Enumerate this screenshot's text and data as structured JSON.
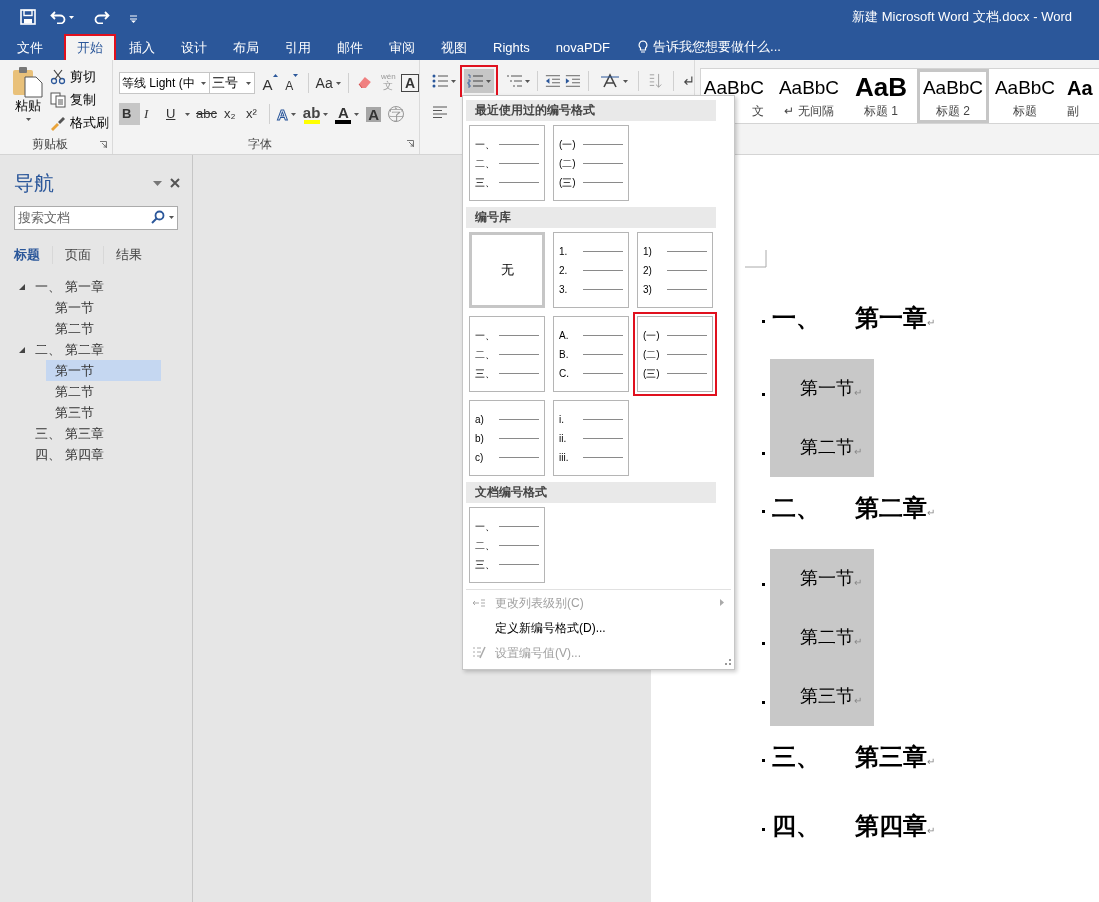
{
  "window": {
    "title": "新建 Microsoft Word 文档.docx - Word"
  },
  "tabs": [
    {
      "label": "文件",
      "selected": false,
      "highlighted": false
    },
    {
      "label": "开始",
      "selected": true,
      "highlighted": true
    },
    {
      "label": "插入",
      "selected": false,
      "highlighted": false
    },
    {
      "label": "设计",
      "selected": false,
      "highlighted": false
    },
    {
      "label": "布局",
      "selected": false,
      "highlighted": false
    },
    {
      "label": "引用",
      "selected": false,
      "highlighted": false
    },
    {
      "label": "邮件",
      "selected": false,
      "highlighted": false
    },
    {
      "label": "审阅",
      "selected": false,
      "highlighted": false
    },
    {
      "label": "视图",
      "selected": false,
      "highlighted": false
    },
    {
      "label": "Rights",
      "selected": false,
      "highlighted": false
    },
    {
      "label": "novaPDF",
      "selected": false,
      "highlighted": false
    }
  ],
  "tell_me": {
    "placeholder": "告诉我您想要做什么..."
  },
  "clipboard": {
    "label": "剪贴板",
    "paste": "粘贴",
    "actions": [
      {
        "label": "剪切",
        "kind": "cut"
      },
      {
        "label": "复制",
        "kind": "copy"
      },
      {
        "label": "格式刷",
        "kind": "painter"
      }
    ]
  },
  "font": {
    "label": "字体",
    "name": "等线 Light (中",
    "size": "三号",
    "size_buttons": [
      {
        "label": "A",
        "kind": "grow"
      },
      {
        "label": "A",
        "kind": "shrink"
      }
    ],
    "change_case": "Aa",
    "phonetic": {
      "top": "wén",
      "bottom": "文"
    },
    "border_char": "A",
    "format_buttons": [
      {
        "label": "B",
        "kind": "bold",
        "selected": true
      },
      {
        "label": "I",
        "kind": "italic",
        "selected": false
      },
      {
        "label": "U",
        "kind": "underline",
        "selected": false
      },
      {
        "label": "abc",
        "kind": "strike",
        "selected": false
      },
      {
        "label": "x₂",
        "kind": "plain",
        "selected": false
      },
      {
        "label": "x²",
        "kind": "plain",
        "selected": false
      }
    ],
    "color_buttons": [
      {
        "label": "A",
        "kind": "effect"
      },
      {
        "label": "ab",
        "kind": "highlight",
        "color": "#ffff00"
      },
      {
        "label": "A",
        "kind": "font_color",
        "color": "#000000"
      },
      {
        "label": "A",
        "kind": "shading"
      },
      {
        "label": "字",
        "kind": "enclose"
      }
    ]
  },
  "numbering_button": {
    "selected": true,
    "highlighted": true
  },
  "styles": [
    {
      "preview": "AaBbC",
      "label": "文",
      "kind": "normal",
      "selected": false
    },
    {
      "preview": "AaBbC",
      "label": "↵ 无间隔",
      "kind": "normal",
      "selected": false
    },
    {
      "preview": "AaB",
      "label": "标题 1",
      "kind": "heading",
      "selected": false
    },
    {
      "preview": "AaBbC",
      "label": "标题 2",
      "kind": "normal",
      "selected": true
    },
    {
      "preview": "AaBbC",
      "label": "标题",
      "kind": "normal",
      "selected": false
    },
    {
      "preview": "Aa",
      "label": "副",
      "kind": "bold",
      "selected": false
    }
  ],
  "navigation": {
    "title": "导航",
    "search": {
      "placeholder": "搜索文档"
    },
    "tabs": [
      {
        "label": "标题",
        "selected": true
      },
      {
        "label": "页面",
        "selected": false
      },
      {
        "label": "结果",
        "selected": false
      }
    ],
    "tree": [
      {
        "label": "一、 第一章",
        "expanded": true,
        "selected": false,
        "children": [
          {
            "label": "第一节",
            "selected": false
          },
          {
            "label": "第二节",
            "selected": false
          }
        ]
      },
      {
        "label": "二、 第二章",
        "expanded": true,
        "selected": false,
        "children": [
          {
            "label": "第一节",
            "selected": true
          },
          {
            "label": "第二节",
            "selected": false
          },
          {
            "label": "第三节",
            "selected": false
          }
        ]
      },
      {
        "label": "三、 第三章",
        "selected": false
      },
      {
        "label": "四、 第四章",
        "selected": false
      }
    ]
  },
  "numbering_menu": {
    "sections": [
      {
        "title": "最近使用过的编号格式",
        "items": [
          {
            "kind": "list",
            "lines": [
              "一、",
              "二、",
              "三、"
            ],
            "selected": false,
            "highlighted": false
          },
          {
            "kind": "list",
            "lines": [
              "(一)",
              "(二)",
              "(三)"
            ],
            "selected": false,
            "highlighted": false
          }
        ]
      },
      {
        "title": "编号库",
        "items": [
          {
            "kind": "none",
            "label": "无",
            "selected": true,
            "highlighted": false
          },
          {
            "kind": "list",
            "lines": [
              "1.",
              "2.",
              "3."
            ],
            "selected": false,
            "highlighted": false
          },
          {
            "kind": "list",
            "lines": [
              "1)",
              "2)",
              "3)"
            ],
            "selected": false,
            "highlighted": false
          },
          {
            "kind": "list",
            "lines": [
              "一、",
              "二、",
              "三、"
            ],
            "selected": false,
            "highlighted": false
          },
          {
            "kind": "list",
            "lines": [
              "A.",
              "B.",
              "C."
            ],
            "selected": false,
            "highlighted": false
          },
          {
            "kind": "list",
            "lines": [
              "(一)",
              "(二)",
              "(三)"
            ],
            "selected": false,
            "highlighted": true
          },
          {
            "kind": "list",
            "lines": [
              "a)",
              "b)",
              "c)"
            ],
            "selected": false,
            "highlighted": false
          },
          {
            "kind": "list",
            "lines": [
              "i.",
              "ii.",
              "iii."
            ],
            "selected": false,
            "highlighted": false
          }
        ]
      },
      {
        "title": "文档编号格式",
        "items": [
          {
            "kind": "list",
            "lines": [
              "一、",
              "二、",
              "三、"
            ],
            "selected": false,
            "highlighted": false
          }
        ]
      }
    ],
    "commands": [
      {
        "label": "更改列表级别(C)",
        "kind": "level",
        "disabled": true
      },
      {
        "label": "定义新编号格式(D)...",
        "kind": "plain",
        "disabled": false
      },
      {
        "label": "设置编号值(V)...",
        "kind": "value",
        "disabled": true
      }
    ]
  },
  "document": {
    "chapters": [
      {
        "number": "一、",
        "title": "第一章",
        "mark": "↵",
        "sections": [
          {
            "text": "第一节",
            "mark": "↵",
            "shaded": true
          },
          {
            "text": "第二节",
            "mark": "↵",
            "shaded": true
          }
        ]
      },
      {
        "number": "二、",
        "title": "第二章",
        "mark": "↵",
        "sections": [
          {
            "text": "第一节",
            "mark": "↵",
            "shaded": true
          },
          {
            "text": "第二节",
            "mark": "↵",
            "shaded": true
          },
          {
            "text": "第三节",
            "mark": "↵",
            "shaded": true
          }
        ]
      },
      {
        "number": "三、",
        "title": "第三章",
        "mark": "↵"
      },
      {
        "number": "四、",
        "title": "第四章",
        "mark": "↵"
      }
    ]
  }
}
